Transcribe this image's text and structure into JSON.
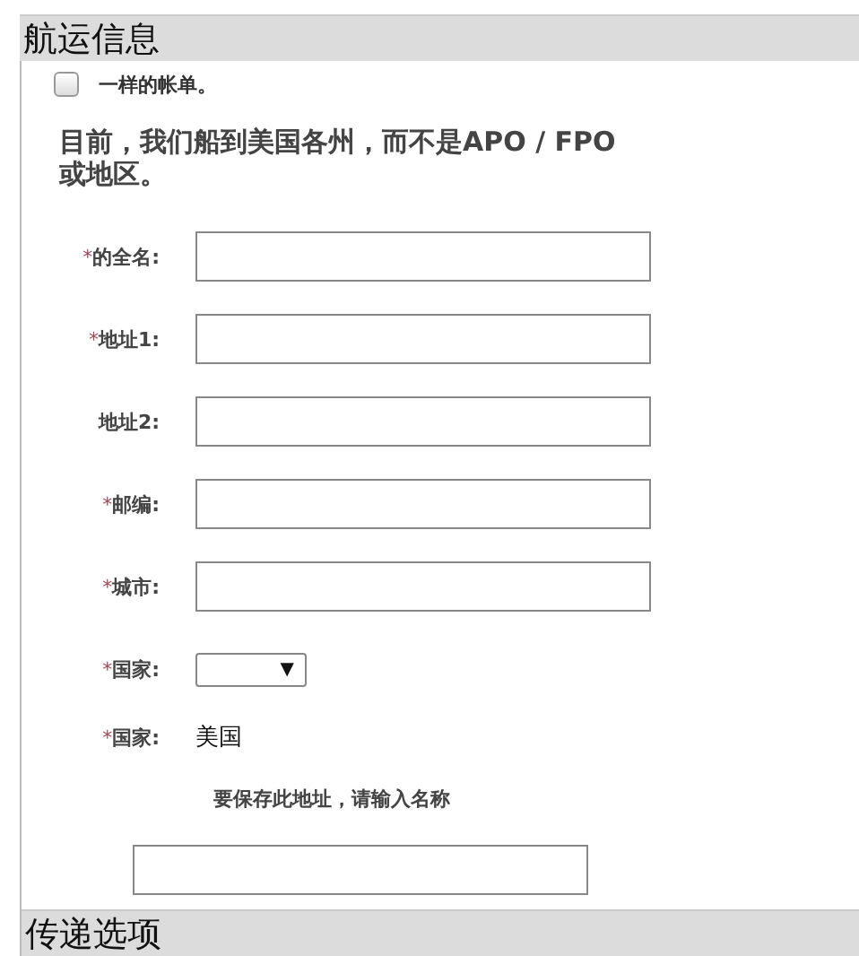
{
  "section_title": "航运信息",
  "same_as_billing": {
    "label": "一样的帐单。",
    "checked": false
  },
  "notice": "目前，我们船到美国各州，而不是APO / FPO 或地区。",
  "fields": [
    {
      "kind": "text",
      "mark": "*",
      "label": "的全名:"
    },
    {
      "kind": "text",
      "mark": "*",
      "label": "地址1:"
    },
    {
      "kind": "text",
      "label": "地址2:"
    },
    {
      "kind": "text",
      "mark": "*",
      "label": "邮编:"
    },
    {
      "kind": "text",
      "mark": "*",
      "label": "城市:"
    },
    {
      "kind": "select",
      "mark": "*",
      "label": "国家:",
      "arrow": "▼"
    },
    {
      "kind": "static",
      "mark": "*",
      "label": "国家:",
      "value": "美国"
    }
  ],
  "save_address": {
    "label": "要保存此地址，请输入名称"
  },
  "next_section_title": "传递选项"
}
